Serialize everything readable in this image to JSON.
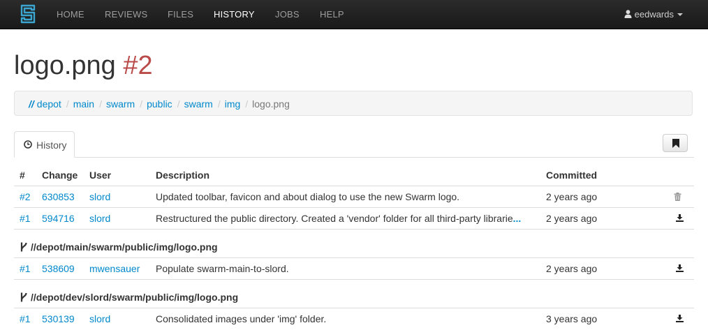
{
  "nav": {
    "logo": "swarm-logo",
    "items": [
      {
        "label": "HOME"
      },
      {
        "label": "REVIEWS"
      },
      {
        "label": "FILES"
      },
      {
        "label": "HISTORY",
        "active": true
      },
      {
        "label": "JOBS"
      },
      {
        "label": "HELP"
      }
    ],
    "user": "eedwards"
  },
  "title": {
    "file": "logo.png",
    "revision": "#2"
  },
  "breadcrumb": {
    "root_slashes": "//",
    "root": "depot",
    "items": [
      "main",
      "swarm",
      "public",
      "swarm",
      "img"
    ],
    "current": "logo.png",
    "separator": "/"
  },
  "tabs": {
    "history_label": "History",
    "history_icon": "clock-icon",
    "bookmark_icon": "bookmark-icon"
  },
  "table": {
    "headers": {
      "num": "#",
      "change": "Change",
      "user": "User",
      "description": "Description",
      "committed": "Committed"
    },
    "rows": [
      {
        "rev": "#2",
        "change": "630853",
        "user": "slord",
        "description": "Updated toolbar, favicon and about dialog to use the new Swarm logo.",
        "committed": "2 years ago",
        "action": "trash-icon"
      },
      {
        "rev": "#1",
        "change": "594716",
        "user": "slord",
        "description": "Restructured the public directory. Created a 'vendor' folder for all third-party librarie",
        "ellipsis": "...",
        "committed": "2 years ago",
        "action": "download-icon"
      }
    ],
    "branches": [
      {
        "path": "//depot/main/swarm/public/img/logo.png",
        "icon": "branch-icon",
        "rows": [
          {
            "rev": "#1",
            "change": "538609",
            "user": "mwensauer",
            "description": "Populate swarm-main-to-slord.",
            "committed": "2 years ago",
            "action": "download-icon"
          }
        ]
      },
      {
        "path": "//depot/dev/slord/swarm/public/img/logo.png",
        "icon": "branch-icon",
        "rows": [
          {
            "rev": "#1",
            "change": "530139",
            "user": "slord",
            "description": "Consolidated images under 'img' folder.",
            "committed": "3 years ago",
            "action": "download-icon"
          }
        ]
      }
    ]
  }
}
